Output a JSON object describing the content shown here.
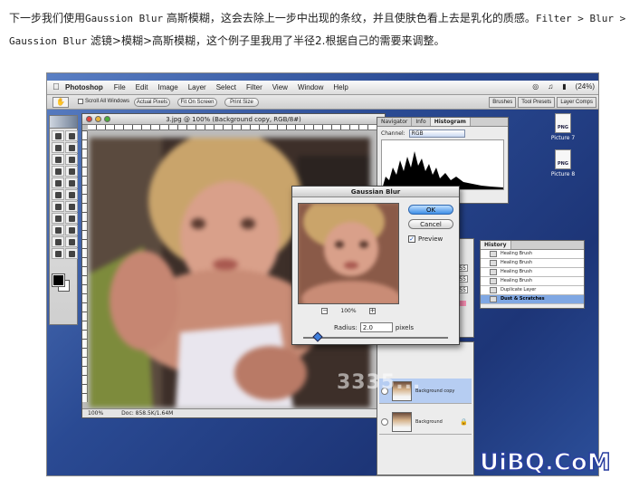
{
  "intro": {
    "line1_a": "下一步我们使用",
    "line1_mono1": "Gaussion Blur",
    "line1_b": " 高斯模糊，这会去除上一步中出现的条纹，并且使肤色看上去是乳化的质感。",
    "line1_mono2": "Filter > Blur >",
    "line2_mono": "Gaussion Blur",
    "line2_b": " 滤镜>模糊>高斯模糊，这个例子里我用了半径2.根据自己的需要来调整。"
  },
  "menubar": {
    "app_name": "Photoshop",
    "items": [
      "File",
      "Edit",
      "Image",
      "Layer",
      "Select",
      "Filter",
      "View",
      "Window",
      "Help"
    ],
    "battery": "(24%)"
  },
  "options_bar": {
    "scroll_all_windows": "Scroll All Windows",
    "actual_pixels": "Actual Pixels",
    "fit_on_screen": "Fit On Screen",
    "print_size": "Print Size",
    "wells": [
      "Brushes",
      "Tool Presets",
      "Layer Comps"
    ]
  },
  "document": {
    "title": "3.jpg @ 100% (Background copy, RGB/8#)",
    "zoom": "100%",
    "doc_size": "Doc: 858.5K/1.64M"
  },
  "gaussian_blur": {
    "title": "Gaussian Blur",
    "ok": "OK",
    "cancel": "Cancel",
    "preview_label": "Preview",
    "preview_checked": true,
    "zoom": "100%",
    "radius_label": "Radius:",
    "radius_value": "2.0",
    "units": "pixels",
    "slider_fraction": 0.1
  },
  "navigator": {
    "tabs": [
      "Navigator",
      "Info",
      "Histogram"
    ],
    "channel_label": "Channel:",
    "channel_value": "RGB"
  },
  "levels_values": [
    "255",
    "255",
    "255"
  ],
  "history": {
    "title": "History",
    "items": [
      "Healing Brush",
      "Healing Brush",
      "Healing Brush",
      "Healing Brush",
      "Duplicate Layer",
      "Dust & Scratches"
    ],
    "active_index": 5
  },
  "layers": {
    "items": [
      "Background copy",
      "Background"
    ],
    "selected_index": 0
  },
  "desktop_icons": [
    "Picture 7",
    "Picture 8"
  ],
  "watermarks": {
    "site": "3335...",
    "brand": "UiBQ.CoM"
  }
}
